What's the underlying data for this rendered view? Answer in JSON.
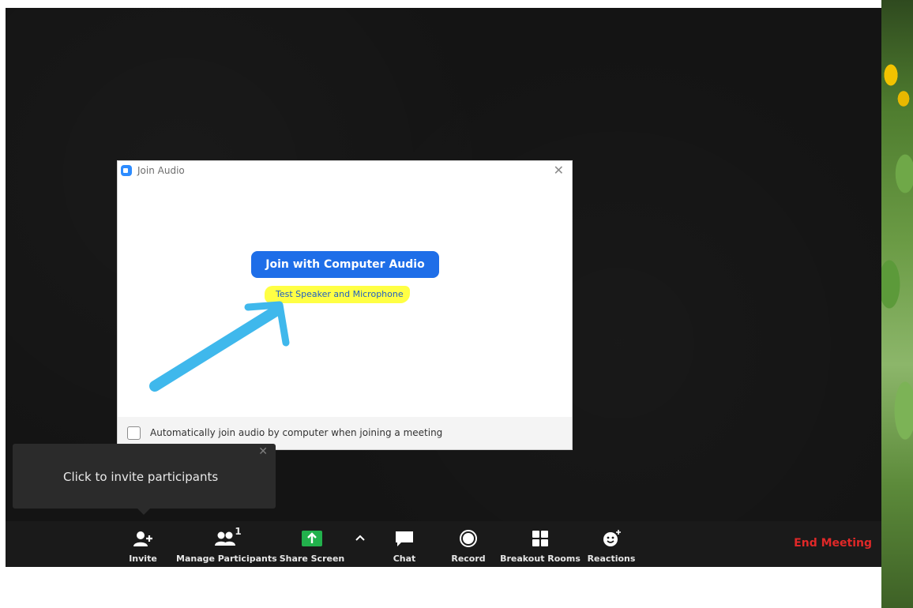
{
  "dialog": {
    "title": "Join Audio",
    "close_icon": "close-icon",
    "join_button_label": "Join with Computer Audio",
    "test_link_label": "Test Speaker and Microphone",
    "auto_join_label": "Automatically join audio by computer when joining a meeting",
    "auto_join_checked": false,
    "accent_color": "#1e6ee8"
  },
  "tooltip": {
    "text": "Click to invite participants"
  },
  "toolbar": {
    "invite_label": "Invite",
    "manage_participants_label": "Manage Participants",
    "participant_count": "1",
    "share_screen_label": "Share Screen",
    "chat_label": "Chat",
    "record_label": "Record",
    "breakout_rooms_label": "Breakout Rooms",
    "reactions_label": "Reactions",
    "end_meeting_label": "End Meeting",
    "end_meeting_color": "#e02828",
    "share_color": "#22b14c"
  }
}
